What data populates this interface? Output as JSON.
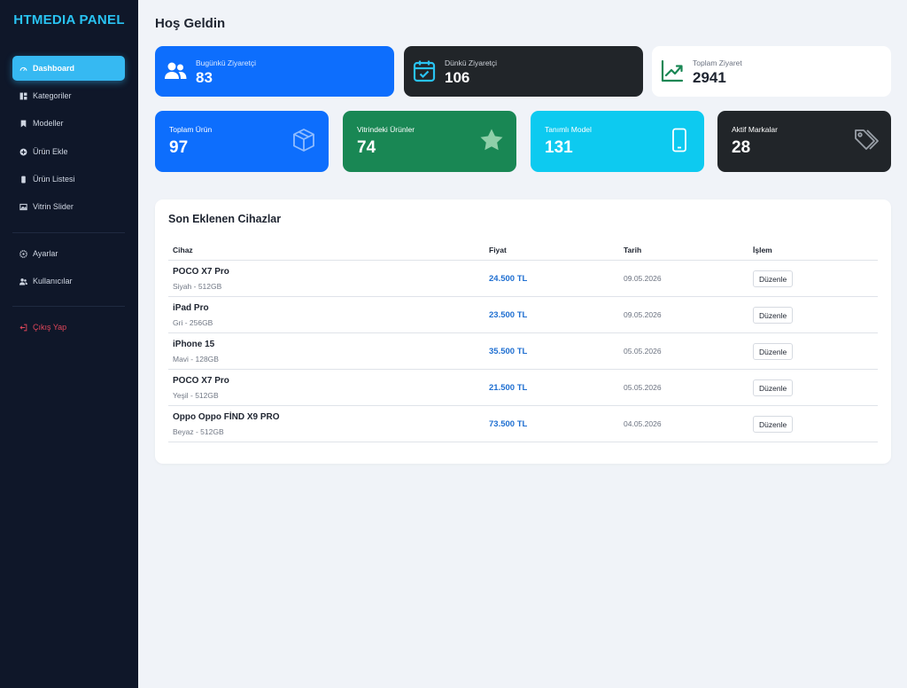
{
  "brand": "HTMEDIA PANEL",
  "nav": [
    {
      "label": "Dashboard",
      "icon": "gauge-icon"
    },
    {
      "label": "Kategoriler",
      "icon": "grid-icon"
    },
    {
      "label": "Modeller",
      "icon": "bookmark-icon"
    },
    {
      "label": "Ürün Ekle",
      "icon": "plus-circle-icon"
    },
    {
      "label": "Ürün Listesi",
      "icon": "phone-icon"
    },
    {
      "label": "Vitrin Slider",
      "icon": "image-icon"
    },
    {
      "label": "Ayarlar",
      "icon": "gear-icon"
    },
    {
      "label": "Kullanıcılar",
      "icon": "users-icon"
    },
    {
      "label": "Çıkış Yap",
      "icon": "logout-icon"
    }
  ],
  "page_title": "Hoş Geldin",
  "visitor_cards": [
    {
      "label": "Bugünkü Ziyaretçi",
      "value": "83",
      "icon": "users-icon",
      "bg": "#0d6efd"
    },
    {
      "label": "Dünkü Ziyaretçi",
      "value": "106",
      "icon": "calendar-check-icon",
      "bg": "#212529"
    },
    {
      "label": "Toplam Ziyaret",
      "value": "2941",
      "icon": "trend-up-icon",
      "bg": "#ffffff"
    }
  ],
  "stat_cards": [
    {
      "label": "Toplam Ürün",
      "value": "97",
      "icon": "box-icon",
      "bg": "#0d6efd"
    },
    {
      "label": "Vitrindeki Ürünler",
      "value": "74",
      "icon": "star-icon",
      "bg": "#198754"
    },
    {
      "label": "Tanımlı Model",
      "value": "131",
      "icon": "phone-icon",
      "bg": "#0dcaf0"
    },
    {
      "label": "Aktif Markalar",
      "value": "28",
      "icon": "tags-icon",
      "bg": "#212529"
    }
  ],
  "recent": {
    "title": "Son Eklenen Cihazlar",
    "headers": [
      "Cihaz",
      "Fiyat",
      "Tarih",
      "İşlem"
    ],
    "rows": [
      {
        "name": "POCO X7 Pro",
        "sub": "Siyah - 512GB",
        "price": "24.500 TL",
        "date": "09.05.2026",
        "action": "Düzenle"
      },
      {
        "name": "iPad Pro",
        "sub": "Gri - 256GB",
        "price": "23.500 TL",
        "date": "09.05.2026",
        "action": "Düzenle"
      },
      {
        "name": "iPhone 15",
        "sub": "Mavi - 128GB",
        "price": "35.500 TL",
        "date": "05.05.2026",
        "action": "Düzenle"
      },
      {
        "name": "POCO X7 Pro",
        "sub": "Yeşil - 512GB",
        "price": "21.500 TL",
        "date": "05.05.2026",
        "action": "Düzenle"
      },
      {
        "name": "Oppo Oppo FİND X9 PRO",
        "sub": "Beyaz - 512GB",
        "price": "73.500 TL",
        "date": "04.05.2026",
        "action": "Düzenle"
      }
    ]
  },
  "colors": {
    "sidebar_bg": "#0f1729",
    "brand": "#29c3f2",
    "active": "#36b9f2",
    "page_bg": "#f0f3f8",
    "price": "#1f6fd1",
    "logout": "#e0465a"
  }
}
